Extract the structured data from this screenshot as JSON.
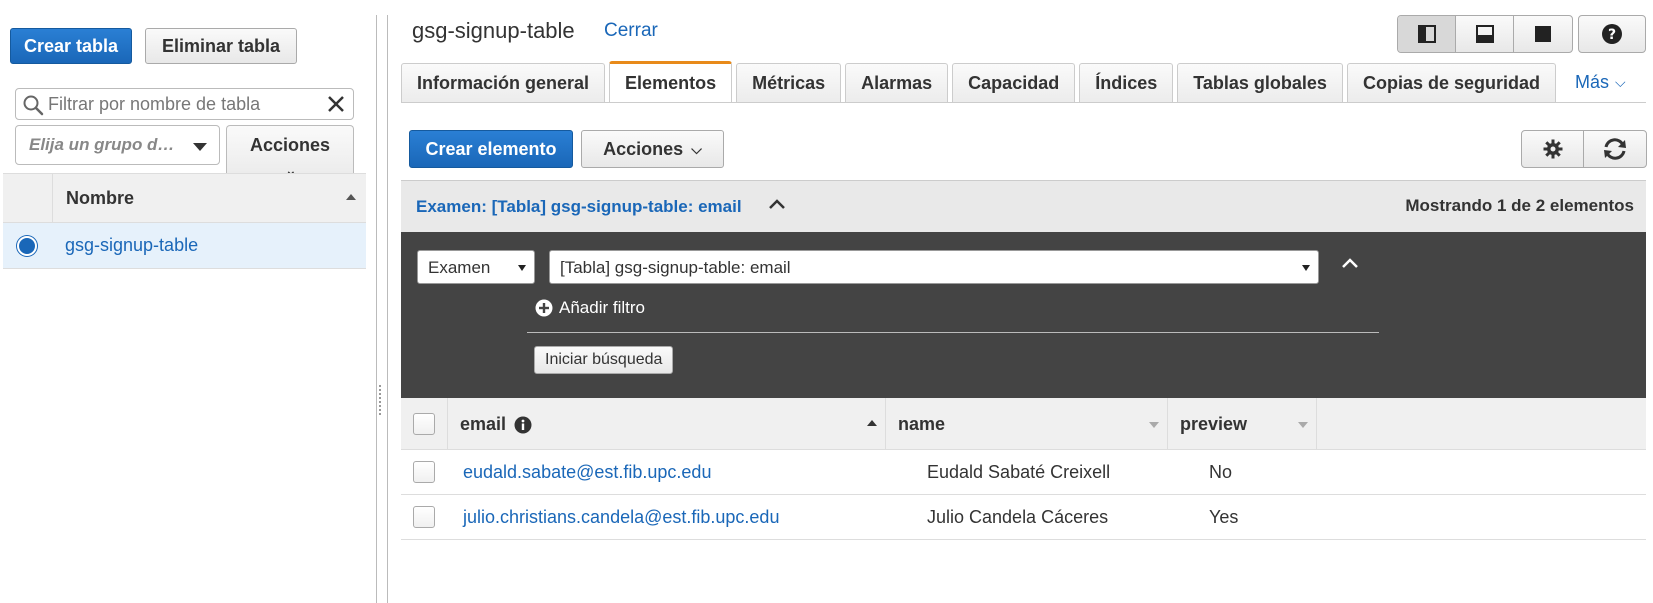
{
  "sidebar": {
    "create_table_label": "Crear tabla",
    "delete_table_label": "Eliminar tabla",
    "filter_placeholder": "Filtrar por nombre de tabla",
    "group_placeholder": "Elija un grupo d…",
    "actions_label": "Acciones",
    "column_name": "Nombre",
    "tables": [
      {
        "name": "gsg-signup-table",
        "selected": true
      }
    ]
  },
  "header": {
    "table_title": "gsg-signup-table",
    "close_link": "Cerrar"
  },
  "tabs": [
    {
      "label": "Información general",
      "active": false
    },
    {
      "label": "Elementos",
      "active": true
    },
    {
      "label": "Métricas",
      "active": false
    },
    {
      "label": "Alarmas",
      "active": false
    },
    {
      "label": "Capacidad",
      "active": false
    },
    {
      "label": "Índices",
      "active": false
    },
    {
      "label": "Tablas globales",
      "active": false
    },
    {
      "label": "Copias de seguridad",
      "active": false
    }
  ],
  "more_tab_label": "Más",
  "toolbar": {
    "create_item_label": "Crear elemento",
    "actions_label": "Acciones"
  },
  "scan": {
    "title": "Examen: [Tabla] gsg-signup-table: email",
    "count_text": "Mostrando 1 de 2 elementos",
    "mode_value": "Examen",
    "table_value": "[Tabla] gsg-signup-table: email",
    "add_filter_label": "Añadir filtro",
    "start_search_label": "Iniciar búsqueda"
  },
  "grid": {
    "columns": [
      "email",
      "name",
      "preview"
    ],
    "rows": [
      {
        "email": "eudald.sabate@est.fib.upc.edu",
        "name": "Eudald Sabaté Creixell",
        "preview": "No"
      },
      {
        "email": "julio.christians.candela@est.fib.upc.edu",
        "name": "Julio Candela Cáceres",
        "preview": "Yes"
      }
    ]
  },
  "colors": {
    "primary_blue": "#1a67b8",
    "active_tab_orange": "#e88a1a",
    "scan_panel_dark": "#444444",
    "selected_row_bg": "#e6f1fb"
  }
}
